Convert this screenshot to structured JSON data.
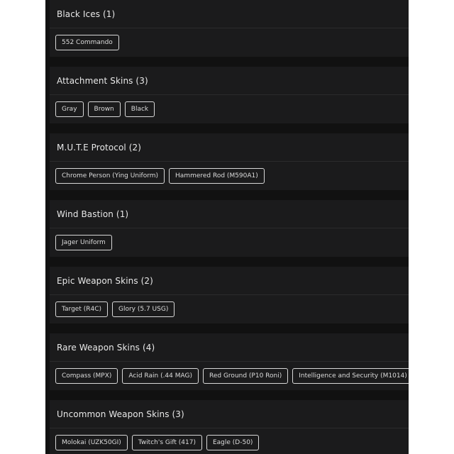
{
  "sections": [
    {
      "title": "Black Ices (1)",
      "tags": [
        "552 Commando"
      ]
    },
    {
      "title": "Attachment Skins (3)",
      "tags": [
        "Gray",
        "Brown",
        "Black"
      ]
    },
    {
      "title": "M.U.T.E Protocol (2)",
      "tags": [
        "Chrome Person (Ying Uniform)",
        "Hammered Rod (M590A1)"
      ]
    },
    {
      "title": "Wind Bastion (1)",
      "tags": [
        "Jager Uniform"
      ]
    },
    {
      "title": "Epic Weapon Skins (2)",
      "tags": [
        "Target (R4C)",
        "Glory (5.7 USG)"
      ]
    },
    {
      "title": "Rare Weapon Skins (4)",
      "tags": [
        "Compass (MPX)",
        "Acid Rain (.44 MAG)",
        "Red Ground (P10 Roni)",
        "Intelligence and Security (M1014)"
      ]
    },
    {
      "title": "Uncommon Weapon Skins (3)",
      "tags": [
        "Molokai (UZK50GI)",
        "Twitch's Gift (417)",
        "Eagle (D-50)"
      ]
    }
  ]
}
